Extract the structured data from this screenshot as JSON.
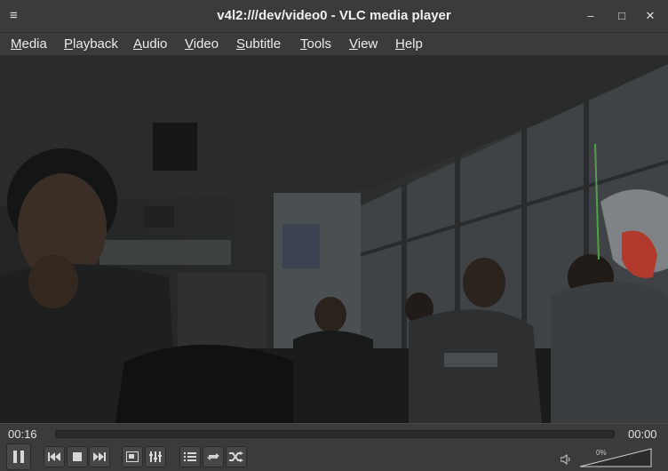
{
  "window": {
    "title": "v4l2:///dev/video0 - VLC media player",
    "minimize_glyph": "–",
    "maximize_glyph": "□",
    "close_glyph": "✕",
    "menu_glyph": "≡"
  },
  "menu": [
    {
      "mnemonic": "M",
      "rest": "edia"
    },
    {
      "mnemonic": "P",
      "rest": "layback"
    },
    {
      "mnemonic": "A",
      "rest": "udio"
    },
    {
      "mnemonic": "V",
      "rest": "ideo"
    },
    {
      "mnemonic": "S",
      "rest": "ubtitle"
    },
    {
      "mnemonic": "T",
      "rest": "ools"
    },
    {
      "mnemonic": "V",
      "rest": "iew"
    },
    {
      "mnemonic": "H",
      "rest": "elp"
    }
  ],
  "playback": {
    "elapsed": "00:16",
    "remaining": "00:00",
    "progress": 0
  },
  "volume": {
    "percent_label": "0%",
    "level": 0
  },
  "icons": {
    "pause": "pause-icon",
    "previous": "skip-previous-icon",
    "stop": "stop-icon",
    "next": "skip-next-icon",
    "fullscreen": "fullscreen-icon",
    "extended": "equalizer-icon",
    "playlist": "playlist-icon",
    "loop": "loop-icon",
    "random": "shuffle-icon",
    "speaker": "speaker-icon"
  },
  "colors": {
    "chrome": "#3b3b3b",
    "video_background": "#1c1d1d"
  }
}
